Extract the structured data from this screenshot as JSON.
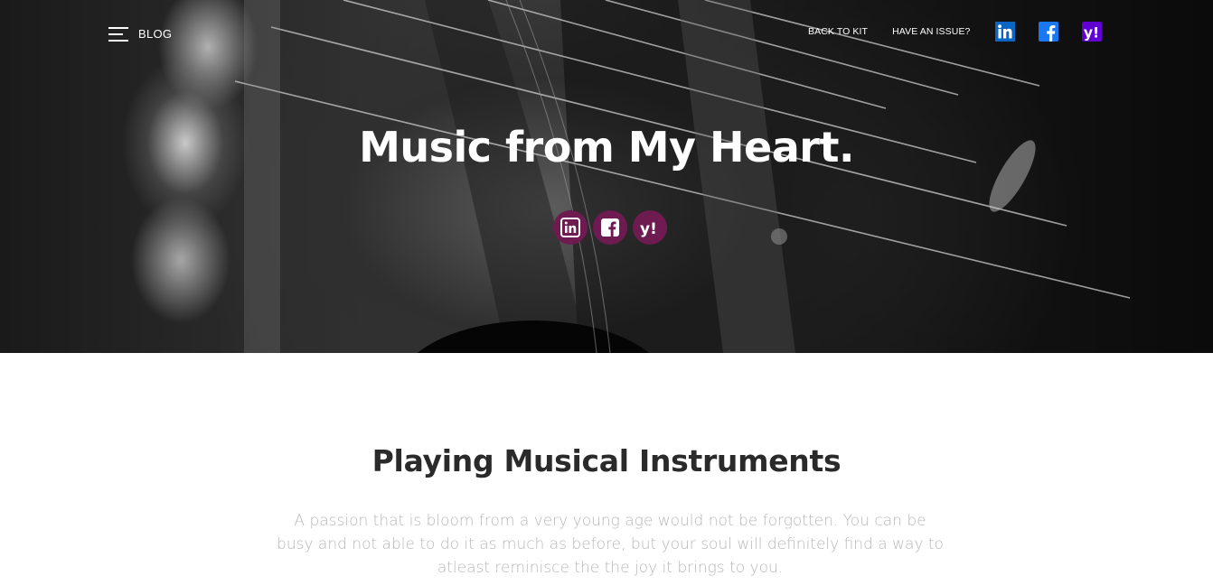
{
  "nav": {
    "blog_label": "BLOG",
    "back_to_kit": "BACK TO KIT",
    "have_issue": "HAVE AN ISSUE?",
    "icons": [
      "linkedin-icon",
      "facebook-icon",
      "yahoo-icon"
    ]
  },
  "hero": {
    "title": "Music from My Heart.",
    "social_icons": [
      "linkedin-icon",
      "facebook-icon",
      "yahoo-icon"
    ],
    "accent_color": "#6e1b52"
  },
  "section": {
    "title": "Playing Musical Instruments",
    "body": "A passion that is bloom from a very young age would not be forgotten. You can be busy and not able to do it as much as before, but your soul will definitely find a way to atleast reminisce the the joy it brings to you."
  },
  "colors": {
    "linkedin": "#0a66c2",
    "facebook": "#1877f2",
    "yahoo": "#6001d2"
  }
}
